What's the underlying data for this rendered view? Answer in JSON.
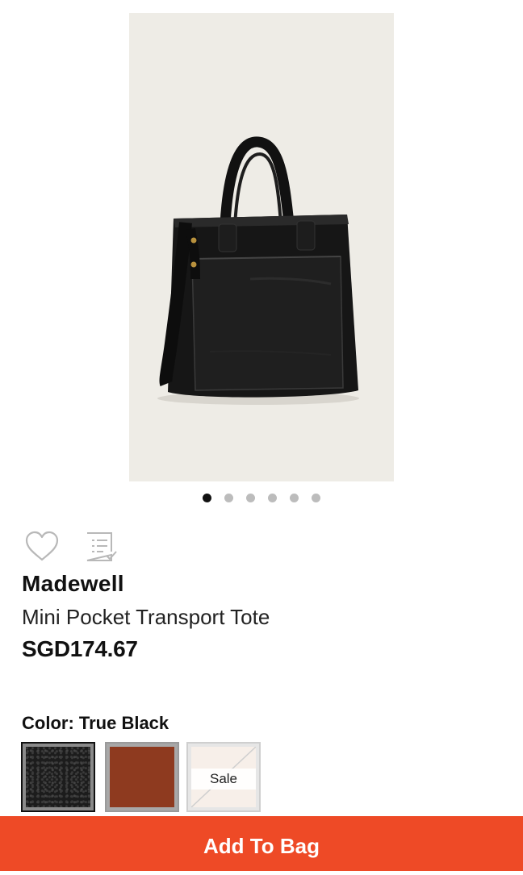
{
  "product": {
    "brand": "Madewell",
    "name": "Mini Pocket Transport Tote",
    "price": "SGD174.67",
    "image_alt": "black leather tote bag"
  },
  "gallery": {
    "total_images": 6,
    "active_index": 0
  },
  "actions": {
    "wishlist_icon": "heart-outline-icon",
    "checklist_icon": "checklist-icon"
  },
  "color": {
    "label": "Color: True Black",
    "swatches": [
      {
        "name": "True Black",
        "color": "#1c1c1c",
        "selected": true
      },
      {
        "name": "Brown",
        "color": "#8e3a1f",
        "selected": false
      },
      {
        "name": "Sale",
        "color": "#f7efe9",
        "selected": false,
        "badge": "Sale"
      }
    ]
  },
  "cta": {
    "add_to_bag": "Add To Bag",
    "color": "#ee4a26"
  }
}
